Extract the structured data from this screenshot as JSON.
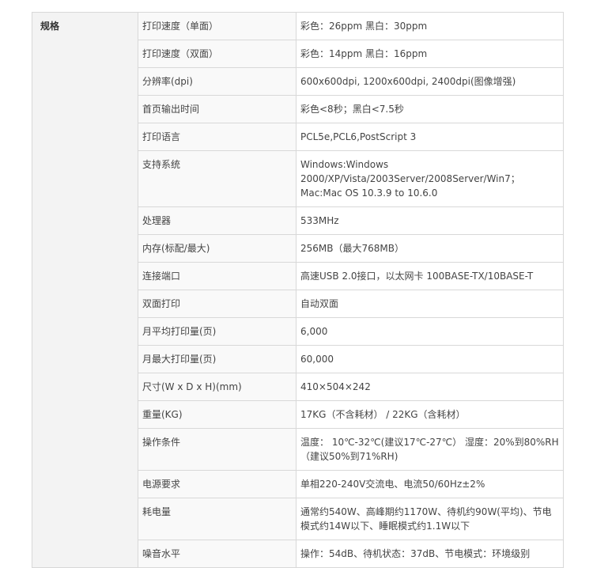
{
  "table": {
    "category": "规格",
    "rows": [
      {
        "key": "打印速度（单面）",
        "value": "彩色：26ppm 黑白：30ppm"
      },
      {
        "key": "打印速度（双面）",
        "value": "彩色：14ppm 黑白：16ppm"
      },
      {
        "key": "分辨率(dpi)",
        "value": "600x600dpi, 1200x600dpi, 2400dpi(图像增强)"
      },
      {
        "key": "首页输出时间",
        "value": "彩色<8秒；黑白<7.5秒"
      },
      {
        "key": "打印语言",
        "value": "PCL5e,PCL6,PostScript 3"
      },
      {
        "key": "支持系统",
        "value": "Windows:Windows 2000/XP/Vista/2003Server/2008Server/Win7；Mac:Mac OS 10.3.9 to 10.6.0"
      },
      {
        "key": "处理器",
        "value": "533MHz"
      },
      {
        "key": "内存(标配/最大)",
        "value": "256MB（最大768MB）"
      },
      {
        "key": "连接端口",
        "value": "高速USB 2.0接口，以太网卡 100BASE-TX/10BASE-T"
      },
      {
        "key": "双面打印",
        "value": "自动双面"
      },
      {
        "key": "月平均打印量(页)",
        "value": "6,000"
      },
      {
        "key": "月最大打印量(页)",
        "value": "60,000"
      },
      {
        "key": "尺寸(W x D x H)(mm)",
        "value": "410×504×242"
      },
      {
        "key": "重量(KG)",
        "value": "17KG（不含耗材） / 22KG（含耗材）"
      },
      {
        "key": "操作条件",
        "value": "温度： 10℃-32℃(建议17℃-27℃） 湿度：20%到80%RH（建议50%到71%RH)"
      },
      {
        "key": "电源要求",
        "value": "单相220-240V交流电、电流50/60Hz±2%"
      },
      {
        "key": "耗电量",
        "value": "通常约540W、高峰期约1170W、待机约90W(平均)、节电模式约14W以下、睡眠模式约1.1W以下"
      },
      {
        "key": "噪音水平",
        "value": "操作：54dB、待机状态：37dB、节电模式：环境级别"
      }
    ]
  }
}
